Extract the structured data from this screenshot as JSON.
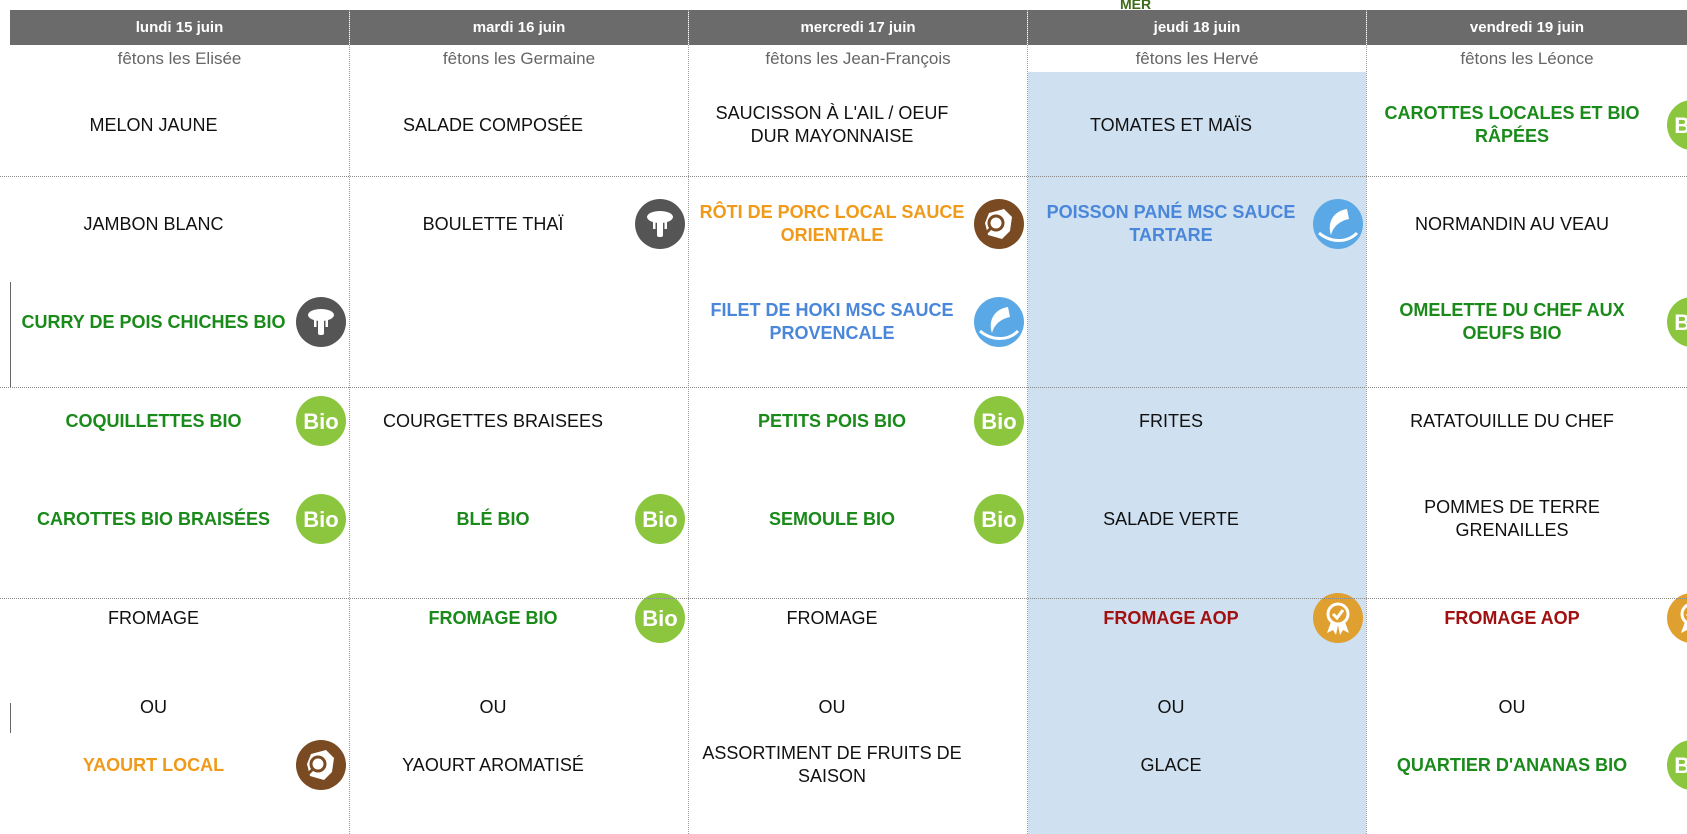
{
  "top_note": "MER",
  "days": [
    {
      "header": "lundi 15 juin",
      "saint": "fêtons les Elisée",
      "slots": [
        {
          "text": "MELON JAUNE",
          "style": "normal",
          "icon": ""
        },
        {
          "text": "JAMBON BLANC",
          "style": "normal",
          "icon": ""
        },
        {
          "text": "CURRY DE POIS CHICHES BIO",
          "style": "green",
          "icon": "veggie-icon"
        },
        {
          "text": "COQUILLETTES BIO",
          "style": "green",
          "icon": "bio-icon"
        },
        {
          "text": "CAROTTES BIO BRAISÉES",
          "style": "green",
          "icon": "bio-icon"
        },
        {
          "text": "FROMAGE",
          "style": "normal",
          "icon": ""
        },
        {
          "text": "OU",
          "style": "normal",
          "icon": ""
        },
        {
          "text": "YAOURT LOCAL",
          "style": "orange",
          "icon": "local-france-icon"
        }
      ]
    },
    {
      "header": "mardi 16 juin",
      "saint": "fêtons les Germaine",
      "slots": [
        {
          "text": "SALADE COMPOSÉE",
          "style": "normal",
          "icon": ""
        },
        {
          "text": "BOULETTE THAÏ",
          "style": "normal",
          "icon": "veggie-icon"
        },
        {
          "text": "",
          "style": "normal",
          "icon": ""
        },
        {
          "text": "COURGETTES BRAISEES",
          "style": "normal",
          "icon": ""
        },
        {
          "text": "BLÉ BIO",
          "style": "green",
          "icon": "bio-icon"
        },
        {
          "text": "FROMAGE BIO",
          "style": "green",
          "icon": "bio-icon"
        },
        {
          "text": "OU",
          "style": "normal",
          "icon": ""
        },
        {
          "text": "YAOURT AROMATISÉ",
          "style": "normal",
          "icon": ""
        }
      ]
    },
    {
      "header": "mercredi 17 juin",
      "saint": "fêtons les Jean-François",
      "slots": [
        {
          "text": "SAUCISSON À L'AIL / OEUF DUR MAYONNAISE",
          "style": "normal",
          "icon": ""
        },
        {
          "text": "RÔTI DE PORC LOCAL SAUCE ORIENTALE",
          "style": "orange",
          "icon": "local-france-icon"
        },
        {
          "text": "FILET DE HOKI MSC SAUCE PROVENCALE",
          "style": "blue",
          "icon": "msc-fish-icon"
        },
        {
          "text": "PETITS POIS BIO",
          "style": "green",
          "icon": "bio-icon"
        },
        {
          "text": "SEMOULE BIO",
          "style": "green",
          "icon": "bio-icon"
        },
        {
          "text": "FROMAGE",
          "style": "normal",
          "icon": ""
        },
        {
          "text": "OU",
          "style": "normal",
          "icon": ""
        },
        {
          "text": "ASSORTIMENT DE FRUITS DE SAISON",
          "style": "normal",
          "icon": ""
        }
      ]
    },
    {
      "header": "jeudi 18 juin",
      "saint": "fêtons les Hervé",
      "slots": [
        {
          "text": "TOMATES ET MAÏS",
          "style": "normal",
          "icon": ""
        },
        {
          "text": "POISSON PANÉ MSC SAUCE TARTARE",
          "style": "blue",
          "icon": "msc-fish-icon"
        },
        {
          "text": "",
          "style": "normal",
          "icon": ""
        },
        {
          "text": "FRITES",
          "style": "normal",
          "icon": ""
        },
        {
          "text": "SALADE VERTE",
          "style": "normal",
          "icon": ""
        },
        {
          "text": "FROMAGE AOP",
          "style": "red",
          "icon": "aop-medal-icon"
        },
        {
          "text": "OU",
          "style": "normal",
          "icon": ""
        },
        {
          "text": "GLACE",
          "style": "normal",
          "icon": ""
        }
      ]
    },
    {
      "header": "vendredi 19 juin",
      "saint": "fêtons les Léonce",
      "slots": [
        {
          "text": "CAROTTES LOCALES ET BIO RÂPÉES",
          "style": "green",
          "icon": "bio-icon"
        },
        {
          "text": "NORMANDIN AU VEAU",
          "style": "normal",
          "icon": ""
        },
        {
          "text": "OMELETTE DU CHEF AUX OEUFS BIO",
          "style": "green",
          "icon": "bio-icon"
        },
        {
          "text": "RATATOUILLE DU CHEF",
          "style": "normal",
          "icon": ""
        },
        {
          "text": "POMMES DE TERRE GRENAILLES",
          "style": "normal",
          "icon": ""
        },
        {
          "text": "FROMAGE AOP",
          "style": "red",
          "icon": "aop-medal-icon"
        },
        {
          "text": "OU",
          "style": "normal",
          "icon": ""
        },
        {
          "text": "QUARTIER D'ANANAS BIO",
          "style": "green",
          "icon": "bio-icon"
        }
      ]
    }
  ],
  "highlighted_day_index": 3,
  "colors": {
    "header_bg": "#6b6b6b",
    "highlight_bg": "#cfe0f1",
    "bio_green": "#1a8a1a",
    "local_orange": "#ef9a1a",
    "msc_blue": "#4a86d9",
    "aop_red": "#a01010",
    "bio_badge": "#8cc63f",
    "veggie_badge": "#555555",
    "local_badge": "#7a4a22",
    "msc_badge": "#5aa9e6",
    "aop_badge": "#e0a030"
  }
}
